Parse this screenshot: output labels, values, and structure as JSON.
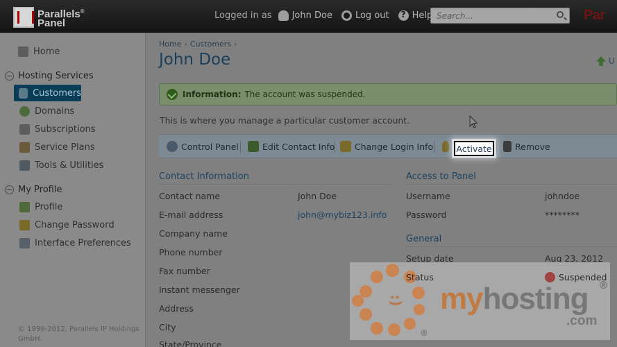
{
  "header": {
    "logo_line1": "Parallels",
    "logo_reg": "®",
    "logo_line2": "Panel",
    "logged_in_prefix": "Logged in as",
    "user_name": "John Doe",
    "logout": "Log out",
    "help": "Help",
    "search_placeholder": "Search...",
    "brand_right": "Par"
  },
  "sidebar": {
    "home": "Home",
    "hosting_section": "Hosting Services",
    "hosting_items": [
      "Customers",
      "Domains",
      "Subscriptions",
      "Service Plans",
      "Tools & Utilities"
    ],
    "active_item": "Customers",
    "profile_section": "My Profile",
    "profile_items": [
      "Profile",
      "Change Password",
      "Interface Preferences"
    ],
    "copyright": "© 1999-2012, Parallels IP Holdings GmbH."
  },
  "breadcrumb": {
    "home": "Home",
    "sep": "›",
    "customers": "Customers"
  },
  "page": {
    "title": "John Doe",
    "corner_link": "U",
    "message_label": "Information:",
    "message_text": "The account was suspended.",
    "description": "This is where you manage a particular customer account."
  },
  "toolbar": {
    "control_panel": "Control Panel",
    "edit_contact": "Edit Contact Info",
    "change_login": "Change Login Info",
    "activate": "Activate",
    "remove": "Remove"
  },
  "contact": {
    "title": "Contact Information",
    "labels": [
      "Contact name",
      "E-mail address",
      "Company name",
      "Phone number",
      "Fax number",
      "Instant messenger",
      "Address",
      "City",
      "State/Province"
    ],
    "contact_name": "John Doe",
    "email": "john@mybiz123.info"
  },
  "access": {
    "title": "Access to Panel",
    "username_label": "Username",
    "username": "johndoe",
    "password_label": "Password",
    "password": "********"
  },
  "general": {
    "title": "General",
    "setup_label": "Setup date",
    "setup_date": "Aug 23, 2012",
    "status_label": "Status",
    "status": "Suspended"
  },
  "watermark": {
    "my": "my",
    "hosting": "hosting",
    "com": ".com",
    "reg": "®"
  },
  "colors": {
    "title_blue": "#1a3f5a",
    "active_nav": "#0a3c55",
    "success_green": "#7a8e6c",
    "watermark_orange": "#c98452"
  }
}
